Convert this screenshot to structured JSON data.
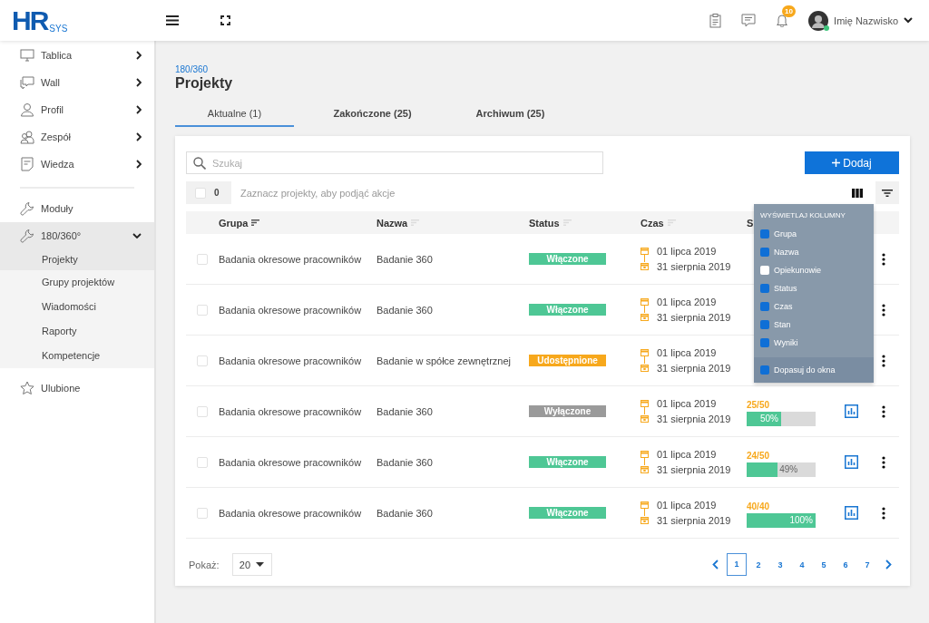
{
  "logo": {
    "main": "HR",
    "sub": "SYS"
  },
  "topbar": {
    "notification_count": "10",
    "user_name": "Imię Nazwisko",
    "user_online": true
  },
  "sidebar": {
    "sections": [
      [
        {
          "label": "Tablica",
          "kind": "monitor",
          "expanded": false
        },
        {
          "label": "Wall",
          "kind": "chat",
          "expanded": false
        },
        {
          "label": "Profil",
          "kind": "person",
          "expanded": false
        },
        {
          "label": "Zespół",
          "kind": "team",
          "expanded": false
        },
        {
          "label": "Wiedza",
          "kind": "document",
          "expanded": false
        }
      ],
      [
        {
          "label": "Moduły",
          "kind": "wrench"
        },
        {
          "label": "180/360°",
          "kind": "wrench",
          "expanded": true,
          "children": [
            {
              "label": "Projekty",
              "selected": true
            },
            {
              "label": "Grupy projektów",
              "selected": false
            },
            {
              "label": "Wiadomości",
              "selected": false
            },
            {
              "label": "Raporty",
              "selected": false
            },
            {
              "label": "Kompetencje",
              "selected": false
            }
          ]
        }
      ],
      [
        {
          "label": "Ulubione",
          "kind": "star"
        }
      ]
    ]
  },
  "breadcrumb": "180/360",
  "title": "Projekty",
  "tabs": [
    {
      "label": "Aktualne (1)",
      "selected": true
    },
    {
      "label": "Zakończone (25)",
      "selected": false
    },
    {
      "label": "Archiwum (25)",
      "selected": false
    }
  ],
  "search": {
    "placeholder": "Szukaj"
  },
  "add_button": "Dodaj",
  "selection": {
    "checked": false,
    "count": "0",
    "hint": "Zaznacz projekty, aby podjąć akcje"
  },
  "toolbar": {
    "columns_active": true,
    "filter_active": false
  },
  "table": {
    "columns": [
      {
        "label": "Grupa",
        "sorted": true
      },
      {
        "label": "Nazwa",
        "sorted": false
      },
      {
        "label": "Status",
        "sorted": false
      },
      {
        "label": "Czas",
        "sorted": false
      },
      {
        "label": "S"
      }
    ],
    "rows": [
      {
        "checked": false,
        "group": "Badania okresowe pracowników",
        "name": "Badanie 360",
        "status": {
          "label": "Włączone",
          "kind": "on"
        },
        "start": "01 lipca 2019",
        "end": "31 sierpnia 2019"
      },
      {
        "checked": false,
        "group": "Badania okresowe pracowników",
        "name": "Badanie 360",
        "status": {
          "label": "Włączone",
          "kind": "on"
        },
        "start": "01 lipca 2019",
        "end": "31 sierpnia 2019"
      },
      {
        "checked": false,
        "group": "Badania okresowe pracowników",
        "name": "Badanie w spółce zewnętrznej",
        "status": {
          "label": "Udostępnione",
          "kind": "shared"
        },
        "start": "01 lipca 2019",
        "end": "31 sierpnia 2019"
      },
      {
        "checked": false,
        "group": "Badania okresowe pracowników",
        "name": "Badanie 360",
        "status": {
          "label": "Wyłączone",
          "kind": "off"
        },
        "start": "01 lipca 2019",
        "end": "31 sierpnia 2019",
        "progress": {
          "score": "25/50",
          "level": 0.5,
          "label": "50%"
        }
      },
      {
        "checked": false,
        "group": "Badania okresowe pracowników",
        "name": "Badanie 360",
        "status": {
          "label": "Włączone",
          "kind": "on"
        },
        "start": "01 lipca 2019",
        "end": "31 sierpnia 2019",
        "progress": {
          "score": "24/50",
          "level": 0.45,
          "label": "49%"
        }
      },
      {
        "checked": false,
        "group": "Badania okresowe pracowników",
        "name": "Badanie 360",
        "status": {
          "label": "Włączone",
          "kind": "on"
        },
        "start": "01 lipca 2019",
        "end": "31 sierpnia 2019",
        "progress": {
          "score": "40/40",
          "level": 1,
          "label": "100%"
        }
      }
    ]
  },
  "column_menu": {
    "title": "WYŚWIETLAJ KOLUMNY",
    "options": [
      {
        "label": "Grupa",
        "checked": true
      },
      {
        "label": "Nazwa",
        "checked": true
      },
      {
        "label": "Opiekunowie",
        "checked": false
      },
      {
        "label": "Status",
        "checked": true
      },
      {
        "label": "Czas",
        "checked": true
      },
      {
        "label": "Stan",
        "checked": true
      },
      {
        "label": "Wyniki",
        "checked": true
      }
    ],
    "fit": {
      "label": "Dopasuj do okna",
      "checked": true
    }
  },
  "pagination": {
    "size_label": "Pokaż:",
    "size": "20",
    "pages": [
      {
        "label": "1",
        "selected": true
      },
      {
        "label": "2",
        "selected": false
      },
      {
        "label": "3",
        "selected": false
      },
      {
        "label": "4",
        "selected": false
      },
      {
        "label": "5",
        "selected": false
      },
      {
        "label": "6",
        "selected": false
      },
      {
        "label": "7",
        "selected": false
      }
    ]
  }
}
